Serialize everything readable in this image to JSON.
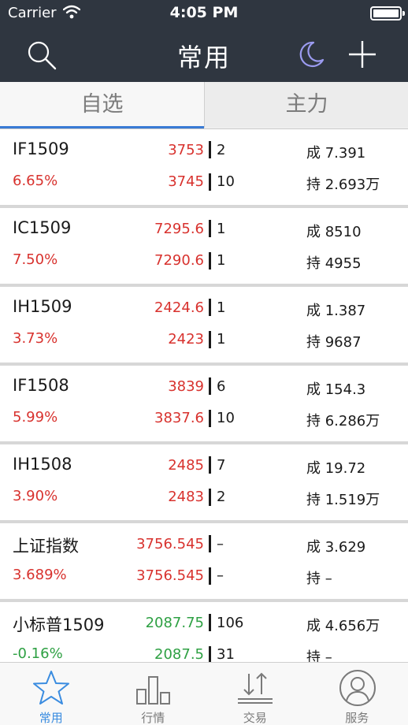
{
  "status_bar": {
    "carrier": "Carrier",
    "time": "4:05 PM"
  },
  "header": {
    "title": "常用",
    "icons": [
      "search-icon",
      "moon-icon",
      "plus-icon"
    ]
  },
  "tabs": [
    {
      "label": "自选",
      "active": true
    },
    {
      "label": "主力",
      "active": false
    }
  ],
  "rows": [
    {
      "name": "IF1509",
      "change_pct": "6.65%",
      "price1": "3753",
      "price2": "3745",
      "vol1": "2",
      "vol2": "10",
      "stat1": "成 7.391",
      "stat2": "持 2.693万",
      "color": "red"
    },
    {
      "name": "IC1509",
      "change_pct": "7.50%",
      "price1": "7295.6",
      "price2": "7290.6",
      "vol1": "1",
      "vol2": "1",
      "stat1": "成 8510",
      "stat2": "持 4955",
      "color": "red"
    },
    {
      "name": "IH1509",
      "change_pct": "3.73%",
      "price1": "2424.6",
      "price2": "2423",
      "vol1": "1",
      "vol2": "1",
      "stat1": "成 1.387",
      "stat2": "持 9687",
      "color": "red"
    },
    {
      "name": "IF1508",
      "change_pct": "5.99%",
      "price1": "3839",
      "price2": "3837.6",
      "vol1": "6",
      "vol2": "10",
      "stat1": "成 154.3",
      "stat2": "持 6.286万",
      "color": "red"
    },
    {
      "name": "IH1508",
      "change_pct": "3.90%",
      "price1": "2485",
      "price2": "2483",
      "vol1": "7",
      "vol2": "2",
      "stat1": "成 19.72",
      "stat2": "持 1.519万",
      "color": "red"
    },
    {
      "name": "上证指数",
      "change_pct": "3.689%",
      "price1": "3756.545",
      "price2": "3756.545",
      "vol1": "–",
      "vol2": "–",
      "stat1": "成 3.629",
      "stat2": "持 –",
      "color": "red"
    },
    {
      "name": "小标普1509",
      "change_pct": "-0.16%",
      "price1": "2087.75",
      "price2": "2087.5",
      "vol1": "106",
      "vol2": "31",
      "stat1": "成 4.656万",
      "stat2": "持 –",
      "color": "green"
    }
  ],
  "tabbar": [
    {
      "label": "常用",
      "icon": "star-icon",
      "active": true
    },
    {
      "label": "行情",
      "icon": "bar-chart-icon",
      "active": false
    },
    {
      "label": "交易",
      "icon": "trade-arrows-icon",
      "active": false
    },
    {
      "label": "服务",
      "icon": "person-icon",
      "active": false
    }
  ],
  "colors": {
    "header_bg": "#2f3640",
    "up": "#d8322e",
    "down": "#2ea043",
    "active_blue": "#3a8ce0",
    "moon": "#9b9bf0"
  }
}
